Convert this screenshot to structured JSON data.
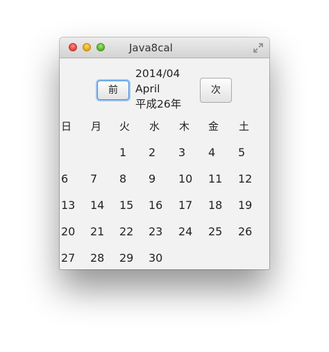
{
  "window": {
    "title": "Java8cal"
  },
  "toolbar": {
    "prev_label": "前",
    "next_label": "次"
  },
  "header": {
    "year_month": "2014/04",
    "month_name": "April",
    "japanese_era": "平成26年"
  },
  "calendar": {
    "weekdays": [
      "日",
      "月",
      "火",
      "水",
      "木",
      "金",
      "土"
    ],
    "weeks": [
      [
        "",
        "",
        "1",
        "2",
        "3",
        "4",
        "5"
      ],
      [
        "6",
        "7",
        "8",
        "9",
        "10",
        "11",
        "12"
      ],
      [
        "13",
        "14",
        "15",
        "16",
        "17",
        "18",
        "19"
      ],
      [
        "20",
        "21",
        "22",
        "23",
        "24",
        "25",
        "26"
      ],
      [
        "27",
        "28",
        "29",
        "30",
        "",
        "",
        ""
      ]
    ]
  },
  "icons": {
    "close": "close-icon",
    "minimize": "minimize-icon",
    "zoom": "zoom-icon",
    "fullscreen": "fullscreen-icon"
  },
  "colors": {
    "window_bg": "#f2f2f2",
    "focus_ring": "#3d8ee0",
    "close": "#e0443a",
    "minimize": "#e5a517",
    "zoom": "#55b02a"
  }
}
